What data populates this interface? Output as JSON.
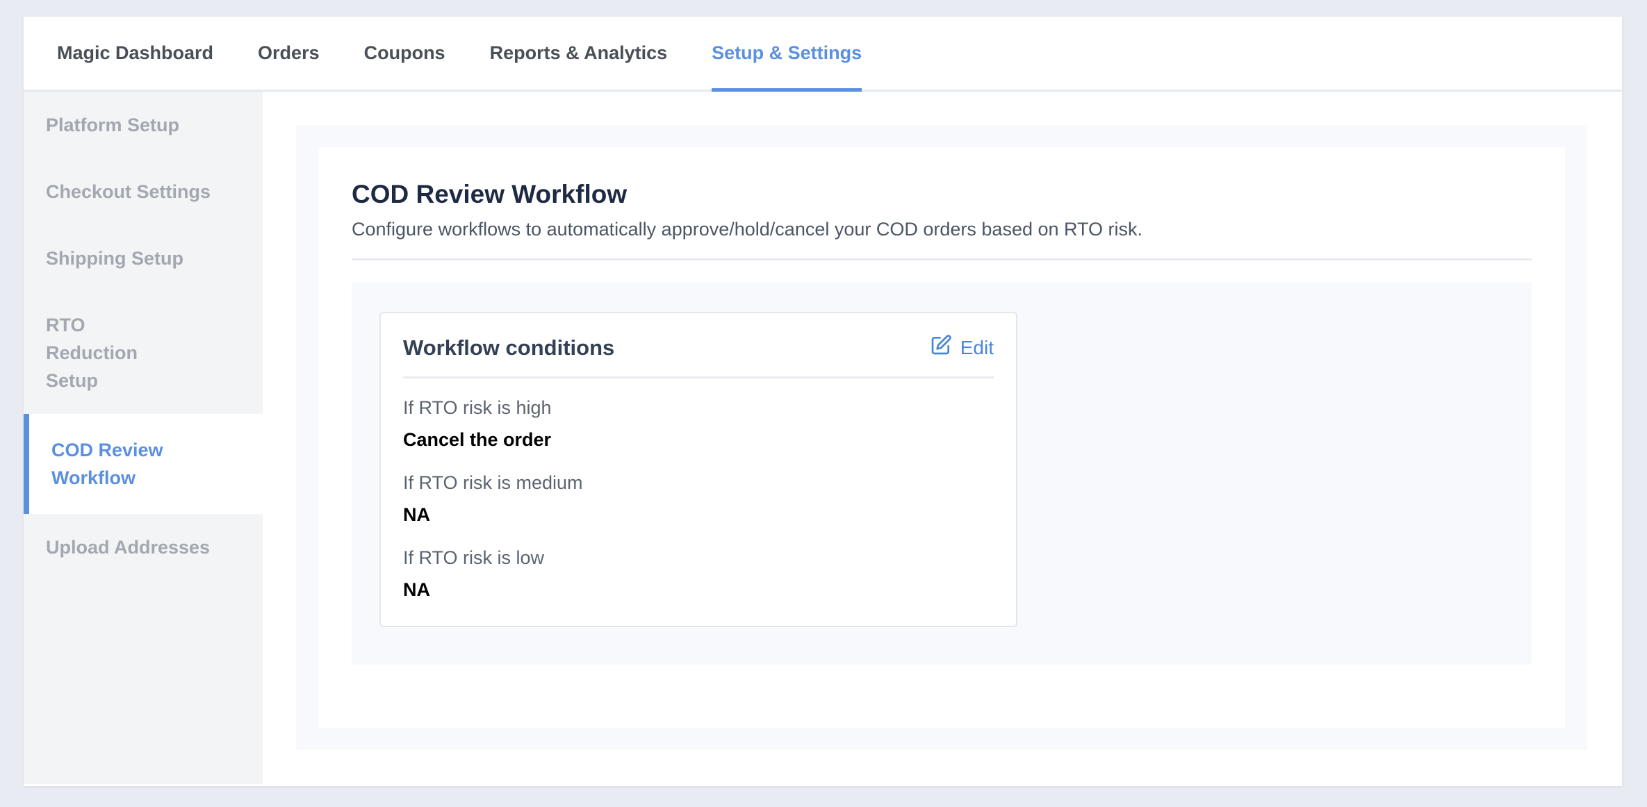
{
  "topnav": {
    "tabs": [
      {
        "label": "Magic Dashboard"
      },
      {
        "label": "Orders"
      },
      {
        "label": "Coupons"
      },
      {
        "label": "Reports & Analytics"
      },
      {
        "label": "Setup & Settings",
        "active": true
      }
    ]
  },
  "sidebar": {
    "items": [
      {
        "label": "Platform Setup"
      },
      {
        "label": "Checkout Settings"
      },
      {
        "label": "Shipping Setup"
      },
      {
        "label": "RTO Reduction Setup"
      },
      {
        "label": "COD Review Workflow",
        "active": true
      },
      {
        "label": "Upload Addresses"
      }
    ]
  },
  "main": {
    "title": "COD Review Workflow",
    "subtitle": "Configure workflows to automatically approve/hold/cancel your COD orders based on RTO risk.",
    "card": {
      "title": "Workflow conditions",
      "edit_label": "Edit",
      "edit_icon": "edit-icon",
      "conditions": [
        {
          "label": "If RTO risk is high",
          "value": "Cancel the order"
        },
        {
          "label": "If RTO risk is medium",
          "value": "NA"
        },
        {
          "label": "If RTO risk is low",
          "value": "NA"
        }
      ]
    }
  },
  "colors": {
    "accent": "#5b8fe0",
    "title": "#1e2a44",
    "background": "#e8ecf2"
  }
}
